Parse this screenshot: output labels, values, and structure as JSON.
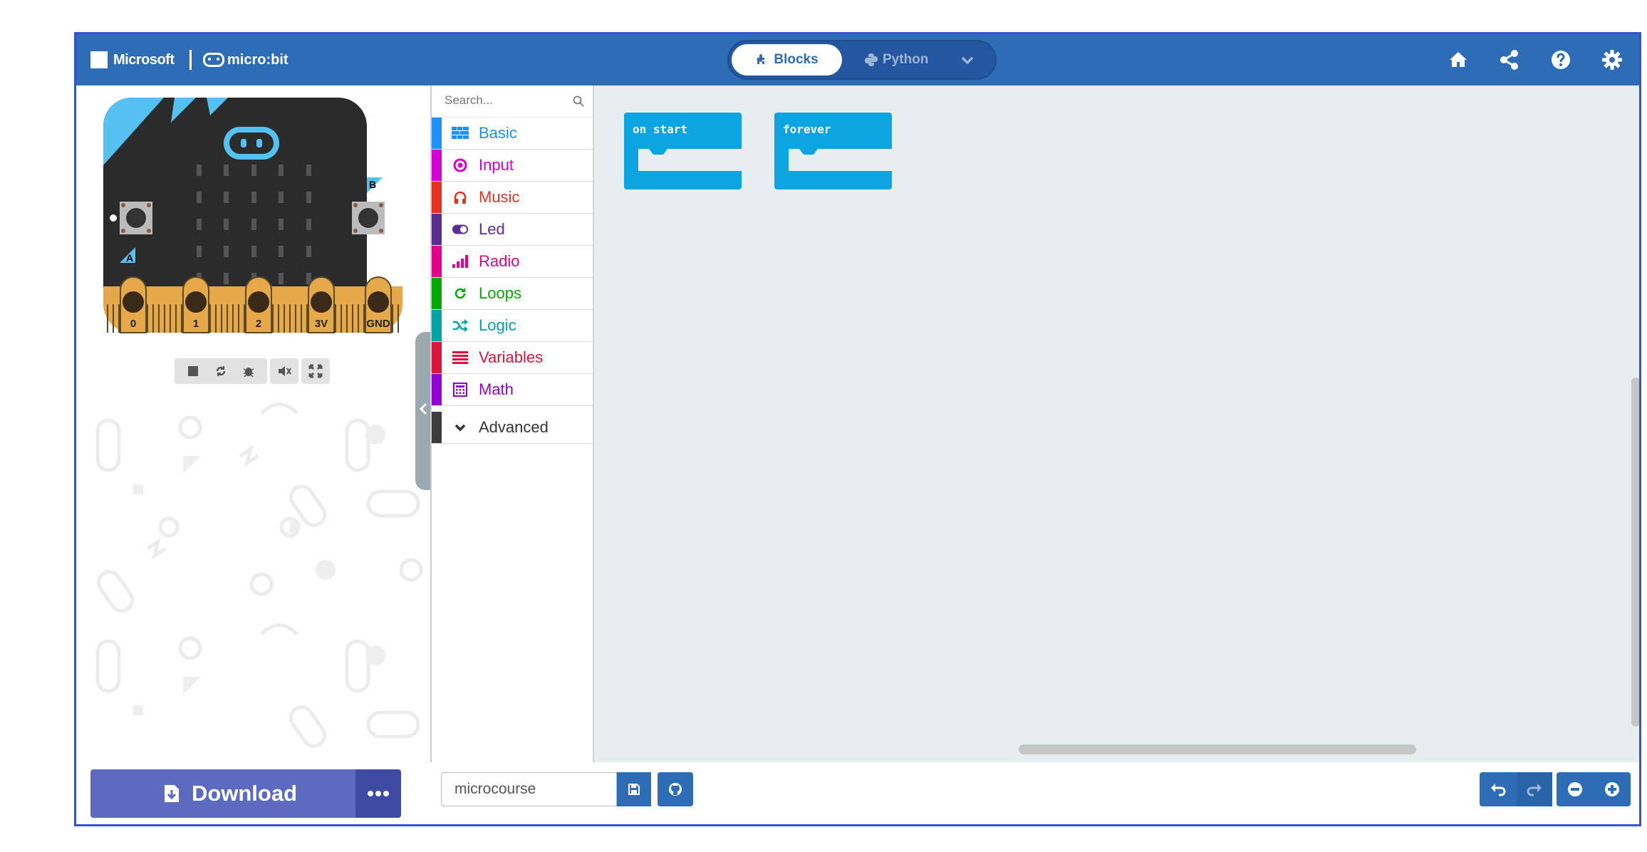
{
  "header": {
    "microsoft_label": "Microsoft",
    "microbit_label": "micro:bit",
    "tabs": {
      "blocks": "Blocks",
      "python": "Python"
    }
  },
  "simulator": {
    "pin_labels": [
      "0",
      "1",
      "2",
      "3V",
      "GND"
    ],
    "button_a": "A",
    "button_b": "B"
  },
  "toolbox": {
    "search_placeholder": "Search...",
    "categories": [
      {
        "label": "Basic",
        "color": "#1e90ff",
        "icon": "grid-icon"
      },
      {
        "label": "Input",
        "color": "#d400d4",
        "icon": "target-icon"
      },
      {
        "label": "Music",
        "color": "#e63022",
        "icon": "headphones-icon"
      },
      {
        "label": "Led",
        "color": "#5c2d91",
        "icon": "toggle-icon"
      },
      {
        "label": "Radio",
        "color": "#e3008c",
        "icon": "signal-icon"
      },
      {
        "label": "Loops",
        "color": "#00aa00",
        "icon": "refresh-icon"
      },
      {
        "label": "Logic",
        "color": "#00a4a6",
        "icon": "shuffle-icon"
      },
      {
        "label": "Variables",
        "color": "#dc143c",
        "icon": "list-icon"
      },
      {
        "label": "Math",
        "color": "#9400d3",
        "icon": "calculator-icon"
      }
    ],
    "advanced_label": "Advanced"
  },
  "workspace": {
    "blocks": [
      {
        "label": "on start"
      },
      {
        "label": "forever"
      }
    ]
  },
  "bottom": {
    "download_label": "Download",
    "project_name": "microcourse"
  },
  "colors": {
    "header": "#2c6db6",
    "block": "#0ca5e1",
    "download": "#5c6bc0",
    "workspace": "#e8edf0"
  }
}
